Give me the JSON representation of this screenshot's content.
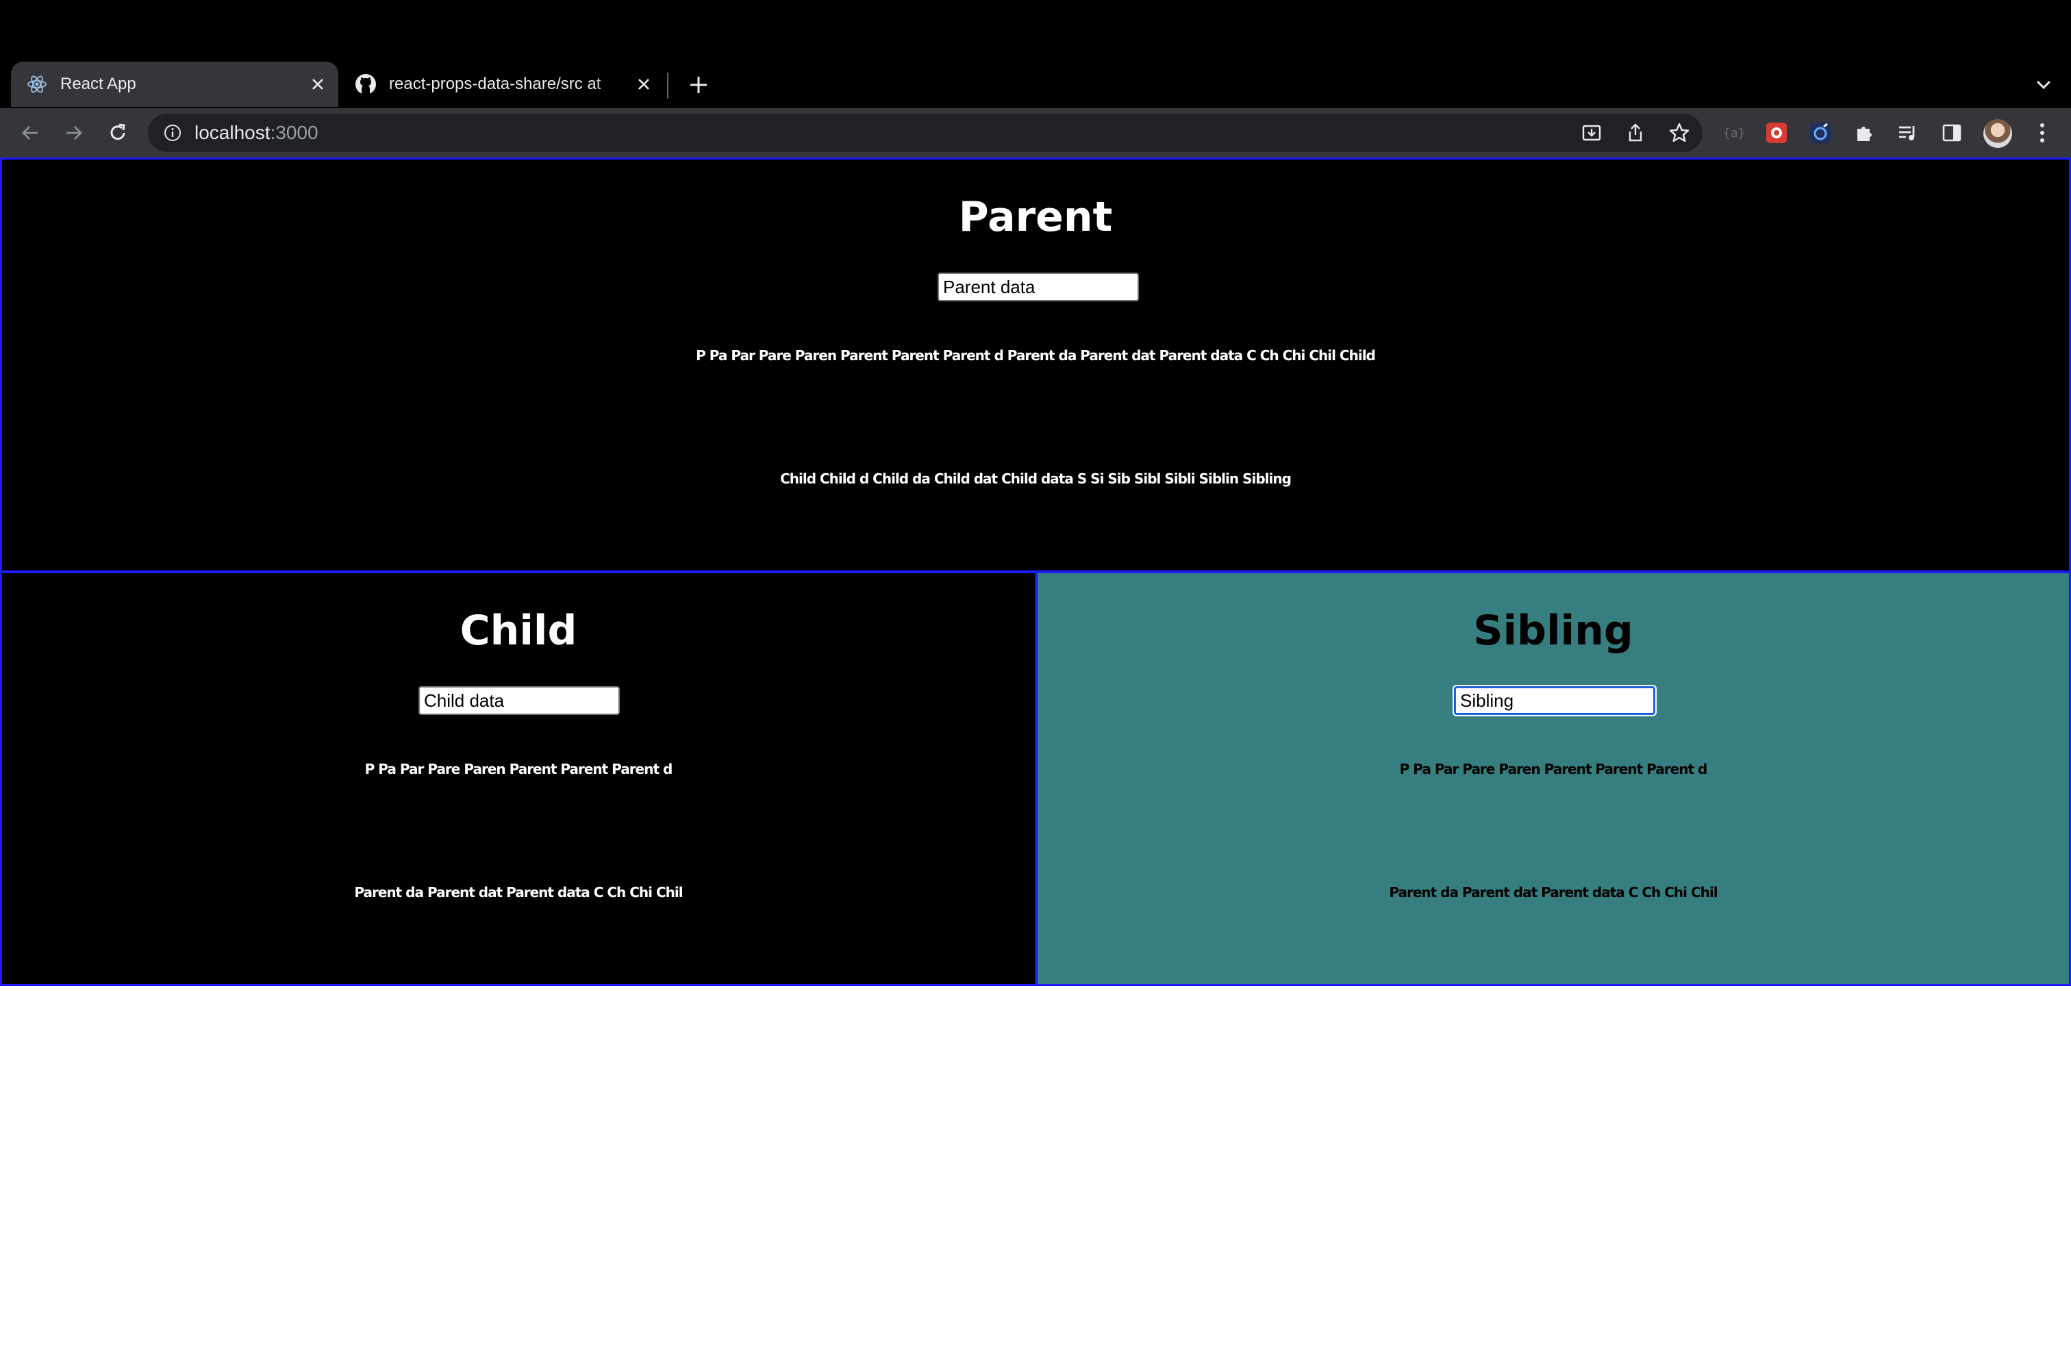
{
  "browser": {
    "tabs": [
      {
        "title": "React App",
        "icon": "react-icon",
        "active": true
      },
      {
        "title": "react-props-data-share/src at",
        "icon": "github-icon",
        "active": false
      }
    ],
    "new_tab_label": "+",
    "url_host": "localhost",
    "url_port": ":3000"
  },
  "parent": {
    "heading": "Parent",
    "input_value": "Parent data",
    "trail_line_1": "P Pa Par Pare Paren Parent Parent Parent d Parent da Parent dat Parent data C Ch Chi Chil Child",
    "trail_line_2": "Child Child d Child da Child dat Child data S Si Sib Sibl Sibli Siblin Sibling"
  },
  "child": {
    "heading": "Child",
    "input_value": "Child data",
    "trail_line_1": "P Pa Par Pare Paren Parent Parent Parent d",
    "trail_line_2": "Parent da Parent dat Parent data C Ch Chi Chil"
  },
  "sibling": {
    "heading": "Sibling",
    "input_value": "Sibling",
    "trail_line_1": "P Pa Par Pare Paren Parent Parent Parent d",
    "trail_line_2": "Parent da Parent dat Parent data C Ch Chi Chil"
  },
  "colors": {
    "box_border": "#1a1aff",
    "sibling_background": "#367e7f",
    "chrome_toolbar": "#35363a"
  }
}
